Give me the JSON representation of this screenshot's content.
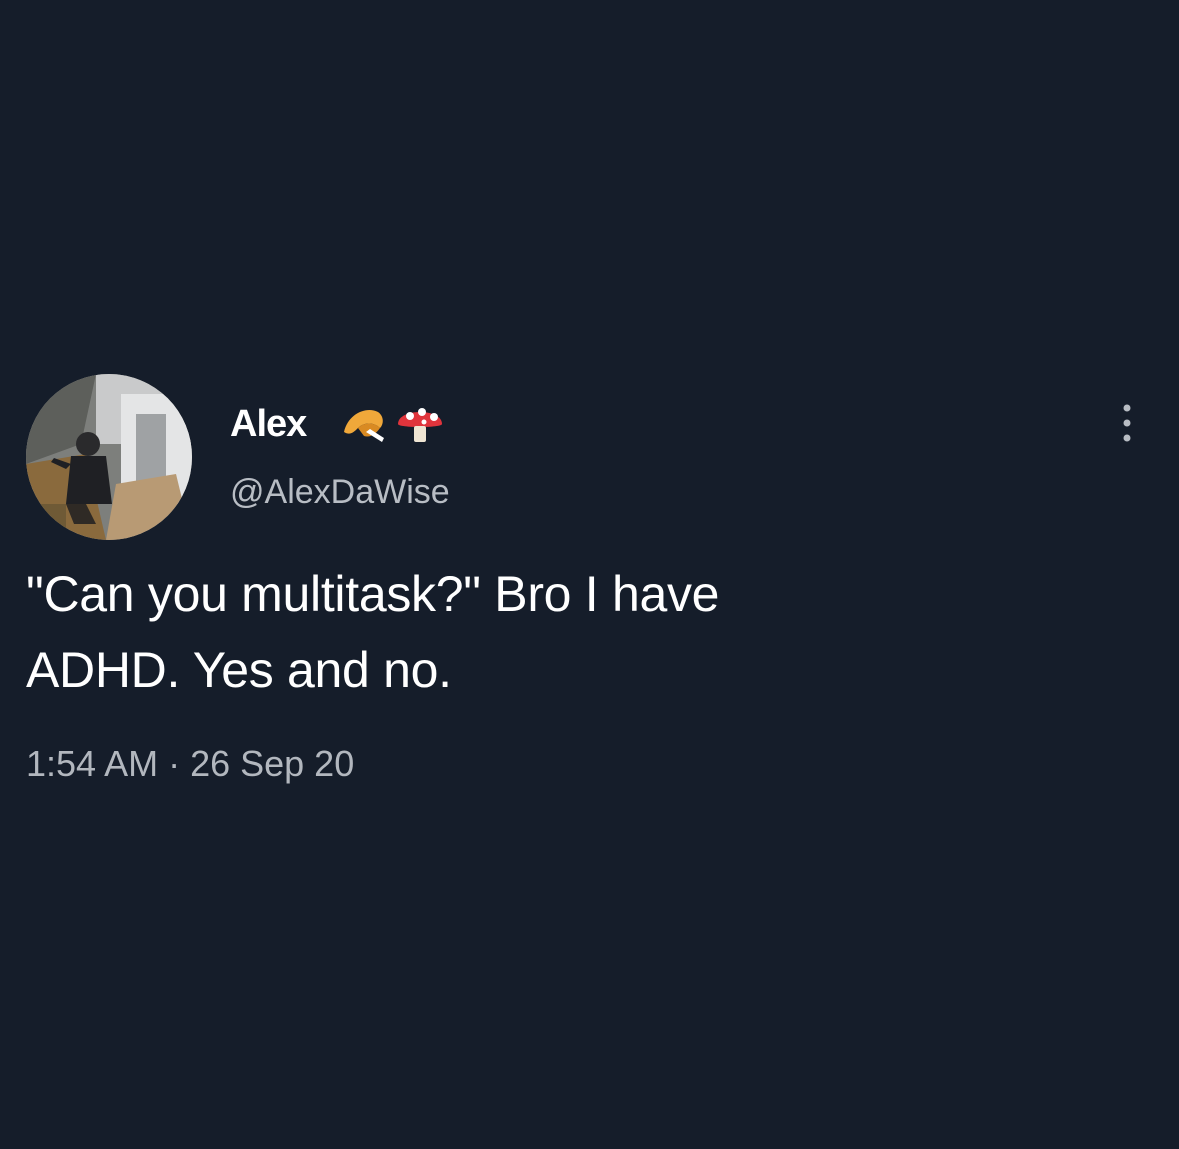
{
  "user": {
    "display_name": "Alex",
    "name_emojis": [
      "fortune-cookie-emoji",
      "mushroom-emoji"
    ],
    "handle": "@AlexDaWise"
  },
  "tweet": {
    "text_line1": "\"Can you multitask?\" Bro I have",
    "text_line2": "ADHD. Yes and no.",
    "timestamp": "1:54 AM · 26 Sep 20"
  },
  "icons": {
    "more": "more-options-icon",
    "avatar": "avatar"
  },
  "colors": {
    "background": "#151d2a",
    "text": "#ffffff",
    "secondary_text": "#b8bdc4"
  }
}
